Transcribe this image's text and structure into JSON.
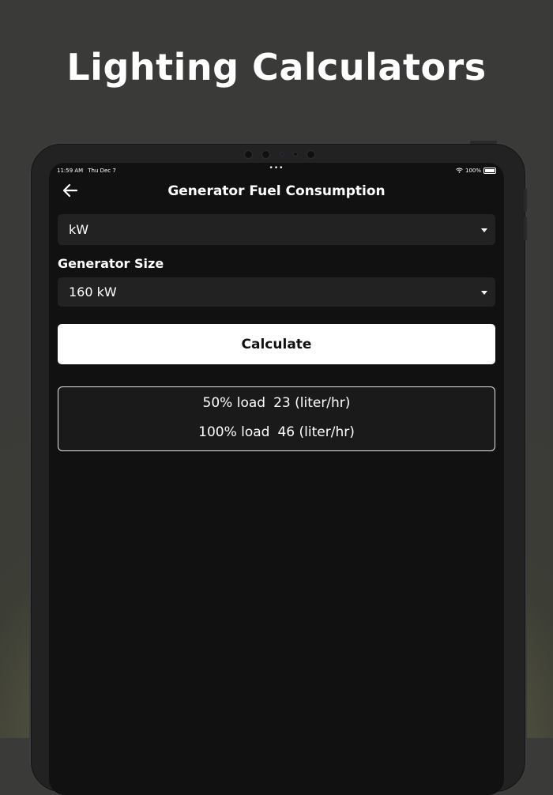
{
  "promo": {
    "title": "Lighting Calculators"
  },
  "status_bar": {
    "time": "11:59 AM",
    "date": "Thu Dec 7",
    "battery": "100%"
  },
  "header": {
    "title": "Generator Fuel Consumption",
    "back_icon": "arrow-left-icon"
  },
  "unit_select": {
    "selected": "kW"
  },
  "generator_size": {
    "label": "Generator Size",
    "selected": "160 kW"
  },
  "calculate_button": {
    "label": "Calculate"
  },
  "results": [
    {
      "load": "50% load",
      "value": "23 (liter/hr)"
    },
    {
      "load": "100% load",
      "value": "46 (liter/hr)"
    }
  ]
}
